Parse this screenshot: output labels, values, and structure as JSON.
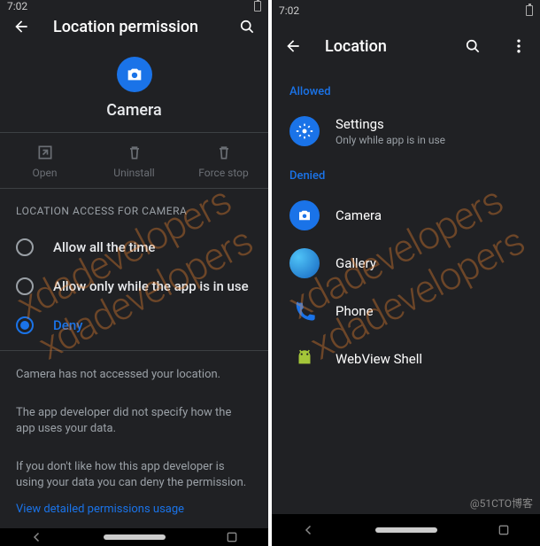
{
  "statusbar": {
    "time": "7:02"
  },
  "left": {
    "title": "Location permission",
    "app_name": "Camera",
    "actions": {
      "open": "Open",
      "uninstall": "Uninstall",
      "force_stop": "Force stop"
    },
    "section_header": "LOCATION ACCESS FOR CAMERA",
    "options": {
      "allow_all": "Allow all the time",
      "allow_while": "Allow only while the app is in use",
      "deny": "Deny"
    },
    "selected": "deny",
    "info1": "Camera has not accessed your location.",
    "info2": "The app developer did not specify how the app uses your data.",
    "info3": "If you don't like how this app developer is using your data you can deny the permission.",
    "link": "View detailed permissions usage"
  },
  "right": {
    "title": "Location",
    "group_allowed": "Allowed",
    "group_denied": "Denied",
    "allowed": [
      {
        "name": "Settings",
        "sub": "Only while app is in use",
        "icon": "gear",
        "bg": "blue"
      }
    ],
    "denied": [
      {
        "name": "Camera",
        "icon": "camera",
        "bg": "blue"
      },
      {
        "name": "Gallery",
        "icon": "swirl",
        "bg": "swirl"
      },
      {
        "name": "Phone",
        "icon": "phone",
        "bg": "none"
      },
      {
        "name": "WebView Shell",
        "icon": "android",
        "bg": "none"
      }
    ]
  },
  "footer_tag": "@51CTO博客",
  "watermark": "xdadevelopers"
}
